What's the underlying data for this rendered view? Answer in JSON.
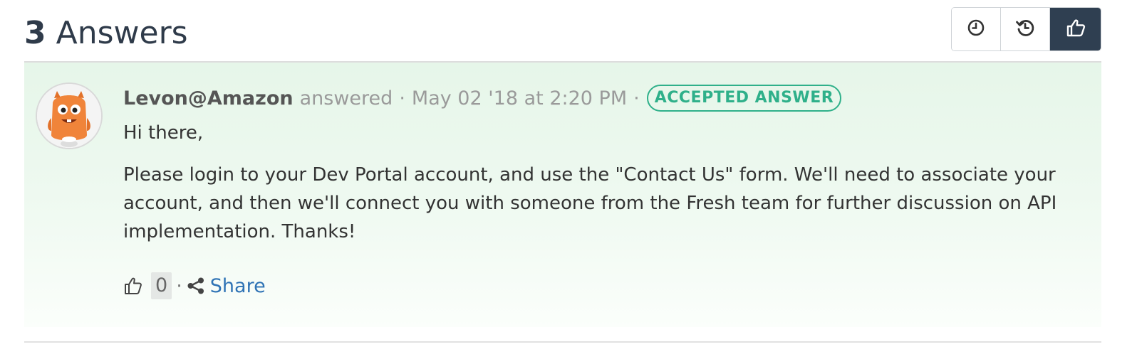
{
  "header": {
    "answer_count": "3",
    "answers_label": "Answers",
    "sort_buttons": [
      {
        "icon": "clock-icon",
        "active": false
      },
      {
        "icon": "history-icon",
        "active": false
      },
      {
        "icon": "thumbs-up-icon",
        "active": true
      }
    ]
  },
  "answer": {
    "author": "Levon@Amazon",
    "action": "answered",
    "separator": "·",
    "timestamp": "May 02 '18 at 2:20 PM",
    "badge": "ACCEPTED ANSWER",
    "greeting": "Hi there,",
    "body": "Please login to your Dev Portal account, and use the \"Contact Us\" form. We'll need to associate your account, and then we'll connect you with someone from the Fresh team for further discussion on API implementation. Thanks!",
    "vote_count": "0",
    "share_label": "Share"
  },
  "colors": {
    "title": "#2f3b4a",
    "accepted": "#2fb08a",
    "link": "#2f73b5",
    "active_sort": "#2f3f51",
    "card_bg": "#e6f6e9"
  }
}
